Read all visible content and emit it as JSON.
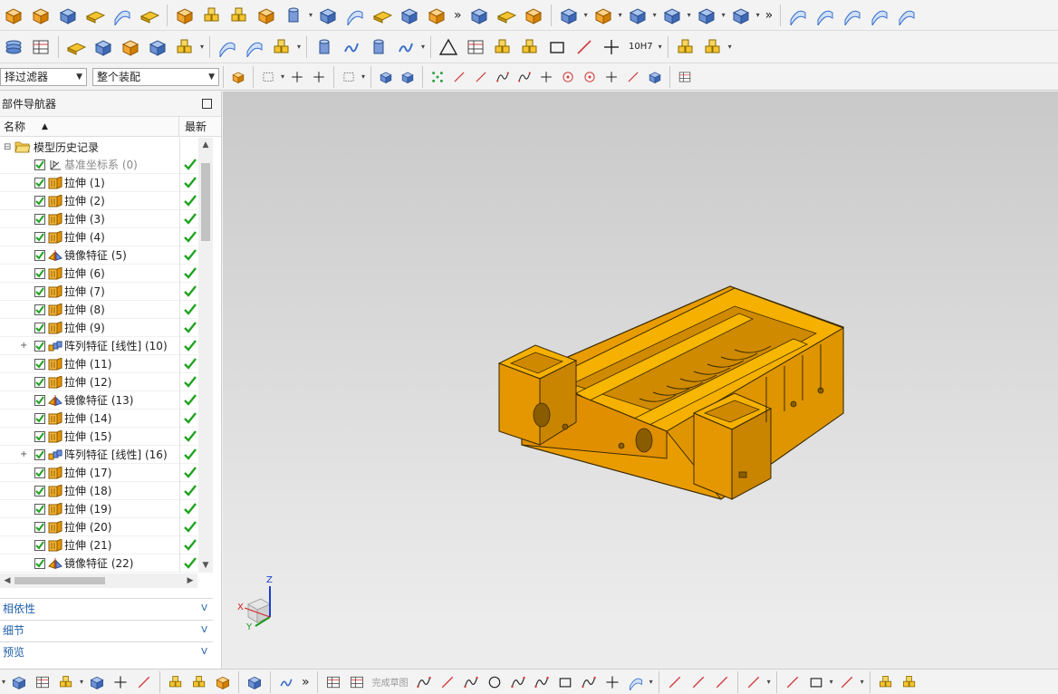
{
  "toolbar": {
    "top_overflow_1": "»",
    "top_overflow_2": "»",
    "bottom_overflow": "»",
    "dimension_tool_label": "10H7"
  },
  "filters": {
    "selection_filter": "择过滤器",
    "assembly_scope": "整个装配"
  },
  "navigator": {
    "title": "部件导航器",
    "columns": {
      "name": "名称",
      "latest": "最新"
    },
    "root": "模型历史记录",
    "items": [
      {
        "label": "基准坐标系 (0)",
        "type": "datum",
        "dim": true
      },
      {
        "label": "拉伸 (1)",
        "type": "extrude"
      },
      {
        "label": "拉伸 (2)",
        "type": "extrude"
      },
      {
        "label": "拉伸 (3)",
        "type": "extrude"
      },
      {
        "label": "拉伸 (4)",
        "type": "extrude"
      },
      {
        "label": "镜像特征 (5)",
        "type": "mirror"
      },
      {
        "label": "拉伸 (6)",
        "type": "extrude"
      },
      {
        "label": "拉伸 (7)",
        "type": "extrude"
      },
      {
        "label": "拉伸 (8)",
        "type": "extrude"
      },
      {
        "label": "拉伸 (9)",
        "type": "extrude"
      },
      {
        "label": "阵列特征 [线性] (10)",
        "type": "pattern",
        "expandable": true
      },
      {
        "label": "拉伸 (11)",
        "type": "extrude"
      },
      {
        "label": "拉伸 (12)",
        "type": "extrude"
      },
      {
        "label": "镜像特征 (13)",
        "type": "mirror"
      },
      {
        "label": "拉伸 (14)",
        "type": "extrude"
      },
      {
        "label": "拉伸 (15)",
        "type": "extrude"
      },
      {
        "label": "阵列特征 [线性] (16)",
        "type": "pattern",
        "expandable": true
      },
      {
        "label": "拉伸 (17)",
        "type": "extrude"
      },
      {
        "label": "拉伸 (18)",
        "type": "extrude"
      },
      {
        "label": "拉伸 (19)",
        "type": "extrude"
      },
      {
        "label": "拉伸 (20)",
        "type": "extrude"
      },
      {
        "label": "拉伸 (21)",
        "type": "extrude"
      },
      {
        "label": "镜像特征 (22)",
        "type": "mirror"
      }
    ],
    "panels": {
      "dependencies": "相依性",
      "details": "细节",
      "preview": "预览"
    }
  },
  "viewport": {
    "triad": {
      "x": "X",
      "y": "Y",
      "z": "Z"
    }
  },
  "sketch": {
    "finish_label": "完成草图"
  },
  "colors": {
    "model": "#f0a400",
    "model_dark": "#b27800",
    "check": "#1fa31f",
    "link": "#1f5fa8"
  }
}
